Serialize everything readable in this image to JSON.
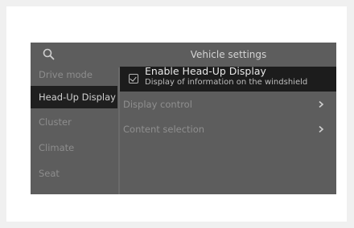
{
  "header": {
    "title": "Vehicle settings",
    "search_icon": "search-icon"
  },
  "sidebar": {
    "items": [
      {
        "label": "Drive mode"
      },
      {
        "label": "Head-Up Display",
        "active": true
      },
      {
        "label": "Cluster"
      },
      {
        "label": "Climate"
      },
      {
        "label": "Seat"
      }
    ]
  },
  "main": {
    "hud_option": {
      "title": "Enable Head-Up Display",
      "subtitle": "Display of information on the windshield",
      "checked": true
    },
    "rows": [
      {
        "label": "Display control",
        "icon": "chevron-right-icon"
      },
      {
        "label": "Content selection",
        "icon": "chevron-right-icon"
      }
    ]
  },
  "colors": {
    "screen_bg": "#5d5d5d",
    "active_bg": "#1f1f1f",
    "text_dim": "#8d8d8d",
    "text_bright": "#e8e8e8"
  }
}
